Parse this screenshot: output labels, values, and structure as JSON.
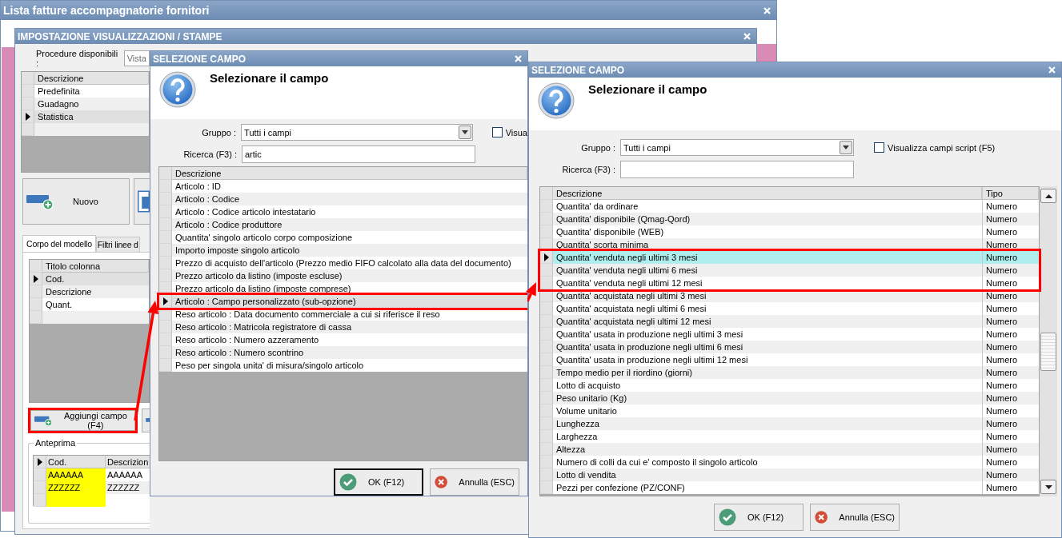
{
  "main_window": {
    "title": "Lista fatture accompagnatorie fornitori"
  },
  "settings_window": {
    "title": "IMPOSTAZIONE VISUALIZZAZIONI / STAMPE",
    "procedure_label": "Procedure disponibili :",
    "procedure_value": "Vista",
    "views": {
      "columns": [
        "Descrizione"
      ],
      "rows": [
        {
          "cells": [
            "Predefinita"
          ],
          "selected": false
        },
        {
          "cells": [
            "Guadagno"
          ],
          "selected": false
        },
        {
          "cells": [
            "Statistica"
          ],
          "selected": true
        }
      ]
    },
    "buttons": [
      {
        "kind": "new",
        "label": "Nuovo"
      },
      {
        "kind": "edit"
      }
    ],
    "tabs": [
      {
        "label": "Corpo del modello",
        "selected": true
      },
      {
        "label": "Filtri linee d",
        "selected": false
      }
    ],
    "columns_grid": {
      "columns": [
        "Titolo colonna"
      ],
      "rows": [
        {
          "cells": [
            "Cod."
          ],
          "selected": true
        },
        {
          "cells": [
            "Descrizione"
          ],
          "selected": false
        },
        {
          "cells": [
            "Quant."
          ],
          "selected": false
        }
      ]
    },
    "panel_buttons": [
      {
        "kind": "add",
        "label": "Aggiungi campo (F4)",
        "highlighted": true
      },
      {
        "kind": "remove"
      }
    ],
    "preview": {
      "title": "Anteprima",
      "header_indicator": true,
      "columns": [
        {
          "label": "Cod.",
          "color": "#ffff00"
        },
        {
          "label": "Descrizion"
        }
      ],
      "rows": [
        {
          "cells": [
            "AAAAAA",
            "AAAAAA"
          ]
        },
        {
          "cells": [
            "ZZZZZZ",
            "ZZZZZZ"
          ]
        }
      ]
    }
  },
  "field_dialogs": [
    {
      "title": "SELEZIONE CAMPO",
      "heading": "Selezionare il campo",
      "group_label": "Gruppo :",
      "group_value": "Tutti i campi",
      "script_checkbox": {
        "label": "Visua",
        "checked": false
      },
      "search_label": "Ricerca (F3) :",
      "search_value": "artic",
      "columns": [
        "Descrizione"
      ],
      "rows": [
        {
          "cells": [
            "Articolo : ID"
          ],
          "selected": false,
          "highlighted": false
        },
        {
          "cells": [
            "Articolo : Codice"
          ],
          "selected": false,
          "highlighted": false
        },
        {
          "cells": [
            "Articolo : Codice articolo intestatario"
          ],
          "selected": false,
          "highlighted": false
        },
        {
          "cells": [
            "Articolo : Codice produttore"
          ],
          "selected": false,
          "highlighted": false
        },
        {
          "cells": [
            "Quantita' singolo articolo corpo composizione"
          ],
          "selected": false,
          "highlighted": false
        },
        {
          "cells": [
            "Importo imposte singolo articolo"
          ],
          "selected": false,
          "highlighted": false
        },
        {
          "cells": [
            "Prezzo di acquisto dell'articolo (Prezzo medio FIFO calcolato alla data del documento)"
          ],
          "selected": false,
          "highlighted": false
        },
        {
          "cells": [
            "Prezzo articolo da listino (imposte escluse)"
          ],
          "selected": false,
          "highlighted": false
        },
        {
          "cells": [
            "Prezzo articolo da listino (imposte comprese)"
          ],
          "selected": false,
          "highlighted": false
        },
        {
          "cells": [
            "Articolo : Campo personalizzato (sub-opzione)"
          ],
          "selected": true,
          "highlighted": true
        },
        {
          "cells": [
            "Reso articolo : Data documento commerciale a cui si riferisce il reso"
          ],
          "selected": false,
          "highlighted": false
        },
        {
          "cells": [
            "Reso articolo : Matricola registratore di cassa"
          ],
          "selected": false,
          "highlighted": false
        },
        {
          "cells": [
            "Reso articolo : Numero azzeramento"
          ],
          "selected": false,
          "highlighted": false
        },
        {
          "cells": [
            "Reso articolo : Numero scontrino"
          ],
          "selected": false,
          "highlighted": false
        },
        {
          "cells": [
            "Peso per singola unita' di misura/singolo articolo"
          ],
          "selected": false,
          "highlighted": false
        }
      ],
      "buttons": [
        {
          "kind": "ok",
          "label": "OK (F12)",
          "focused": true
        },
        {
          "kind": "cancel",
          "label": "Annulla (ESC)",
          "focused": false
        }
      ]
    },
    {
      "title": "SELEZIONE CAMPO",
      "heading": "Selezionare il campo",
      "group_label": "Gruppo :",
      "group_value": "Tutti i campi",
      "script_checkbox": {
        "label": "Visualizza campi script (F5)",
        "checked": false
      },
      "search_label": "Ricerca (F3) :",
      "columns": [
        "Descrizione",
        "Tipo"
      ],
      "rows": [
        {
          "cells": [
            "Quantita' da ordinare",
            "Numero"
          ],
          "selected": false,
          "highlighted": false
        },
        {
          "cells": [
            "Quantita' disponibile (Qmag-Qord)",
            "Numero"
          ],
          "selected": false,
          "highlighted": false
        },
        {
          "cells": [
            "Quantita' disponibile (WEB)",
            "Numero"
          ],
          "selected": false,
          "highlighted": false
        },
        {
          "cells": [
            "Quantita' scorta minima",
            "Numero"
          ],
          "selected": false,
          "highlighted": false
        },
        {
          "cells": [
            "Quantita' venduta negli ultimi 3 mesi",
            "Numero"
          ],
          "selected": true,
          "highlighted": true
        },
        {
          "cells": [
            "Quantita' venduta negli ultimi 6 mesi",
            "Numero"
          ],
          "selected": false,
          "highlighted": true
        },
        {
          "cells": [
            "Quantita' venduta negli ultimi 12 mesi",
            "Numero"
          ],
          "selected": false,
          "highlighted": true
        },
        {
          "cells": [
            "Quantita' acquistata negli ultimi 3 mesi",
            "Numero"
          ],
          "selected": false,
          "highlighted": false
        },
        {
          "cells": [
            "Quantita' acquistata negli ultimi 6 mesi",
            "Numero"
          ],
          "selected": false,
          "highlighted": false
        },
        {
          "cells": [
            "Quantita' acquistata negli ultimi 12 mesi",
            "Numero"
          ],
          "selected": false,
          "highlighted": false
        },
        {
          "cells": [
            "Quantita' usata in produzione negli ultimi 3 mesi",
            "Numero"
          ],
          "selected": false,
          "highlighted": false
        },
        {
          "cells": [
            "Quantita' usata in produzione negli ultimi 6 mesi",
            "Numero"
          ],
          "selected": false,
          "highlighted": false
        },
        {
          "cells": [
            "Quantita' usata in produzione negli ultimi 12 mesi",
            "Numero"
          ],
          "selected": false,
          "highlighted": false
        },
        {
          "cells": [
            "Tempo medio per il riordino (giorni)",
            "Numero"
          ],
          "selected": false,
          "highlighted": false
        },
        {
          "cells": [
            "Lotto di acquisto",
            "Numero"
          ],
          "selected": false,
          "highlighted": false
        },
        {
          "cells": [
            "Peso unitario (Kg)",
            "Numero"
          ],
          "selected": false,
          "highlighted": false
        },
        {
          "cells": [
            "Volume unitario",
            "Numero"
          ],
          "selected": false,
          "highlighted": false
        },
        {
          "cells": [
            "Lunghezza",
            "Numero"
          ],
          "selected": false,
          "highlighted": false
        },
        {
          "cells": [
            "Larghezza",
            "Numero"
          ],
          "selected": false,
          "highlighted": false
        },
        {
          "cells": [
            "Altezza",
            "Numero"
          ],
          "selected": false,
          "highlighted": false
        },
        {
          "cells": [
            "Numero di colli da cui e' composto il singolo articolo",
            "Numero"
          ],
          "selected": false,
          "highlighted": false
        },
        {
          "cells": [
            "Lotto di vendita",
            "Numero"
          ],
          "selected": false,
          "highlighted": false
        },
        {
          "cells": [
            "Pezzi per confezione (PZ/CONF)",
            "Numero"
          ],
          "selected": false,
          "highlighted": false
        }
      ],
      "buttons": [
        {
          "kind": "ok",
          "label": "OK (F12)",
          "focused": false
        },
        {
          "kind": "cancel",
          "label": "Annulla (ESC)",
          "focused": false
        }
      ]
    }
  ]
}
